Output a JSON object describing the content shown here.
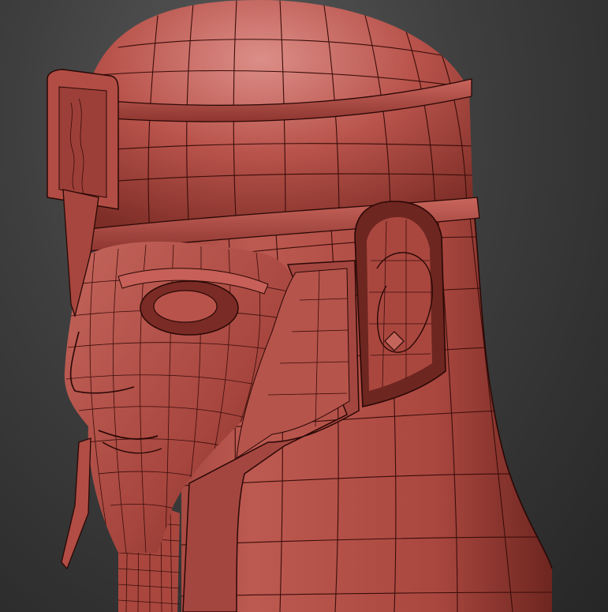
{
  "scene": {
    "subject": "wireframe-helmet-head",
    "colors": {
      "background_top": "#5a5a5a",
      "background_bottom": "#262626",
      "clay": "#b8534b",
      "clay_highlight": "#d88882",
      "clay_shadow": "#6e2620",
      "wire": "#3a0d09"
    }
  }
}
